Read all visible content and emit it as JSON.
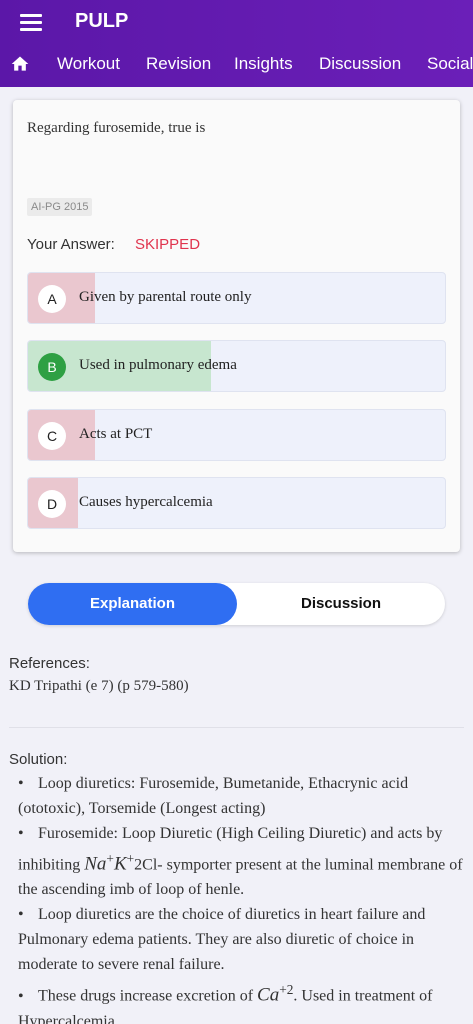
{
  "app": {
    "title": "PULP"
  },
  "nav": {
    "tabs": [
      "Workout",
      "Revision",
      "Insights",
      "Discussion",
      "Social"
    ]
  },
  "question": {
    "text": "Regarding furosemide, true is",
    "tag": "AI-PG 2015",
    "answer_label": "Your Answer:",
    "answer_value": "SKIPPED"
  },
  "options": [
    {
      "letter": "A",
      "text": "Given by parental route only",
      "percent": 16,
      "correct": false
    },
    {
      "letter": "B",
      "text": "Used in pulmonary edema",
      "percent": 44,
      "correct": true
    },
    {
      "letter": "C",
      "text": "Acts at PCT",
      "percent": 16,
      "correct": false
    },
    {
      "letter": "D",
      "text": "Causes hypercalcemia",
      "percent": 12,
      "correct": false
    }
  ],
  "colors": {
    "correct_fill": "#c7e6cf",
    "wrong_fill": "#eac7cf",
    "correct_badge": "#2ea043",
    "accent": "#2f6ef2",
    "skipped": "#e0344e"
  },
  "toggle": {
    "explanation": "Explanation",
    "discussion": "Discussion"
  },
  "references": {
    "heading": "References:",
    "text": "KD Tripathi (e 7) (p 579-580)"
  },
  "solution": {
    "heading": "Solution:",
    "bullet": "•",
    "b1": "Loop diuretics: Furosemide, Bumetanide, Ethacrynic acid (ototoxic), Torsemide (Longest acting)",
    "b2_pre": "Furosemide: Loop Diuretic (High Ceiling Diuretic) and acts by inhibiting",
    "b2_na": "Na",
    "b2_k": "K",
    "b2_plus": "+",
    "b2_2cl": "2Cl",
    "b2_post": "- symporter present at the luminal membrane of the ascending imb of loop of henle.",
    "b3": "Loop diuretics are the choice of diuretics in heart failure and Pulmonary edema patients. They are also diuretic of choice in moderate to severe renal failure.",
    "b4_pre": "These drugs increase excretion of",
    "b4_ca": "Ca",
    "b4_sup": "+2",
    "b4_post": ". Used in treatment of Hypercalcemia."
  }
}
